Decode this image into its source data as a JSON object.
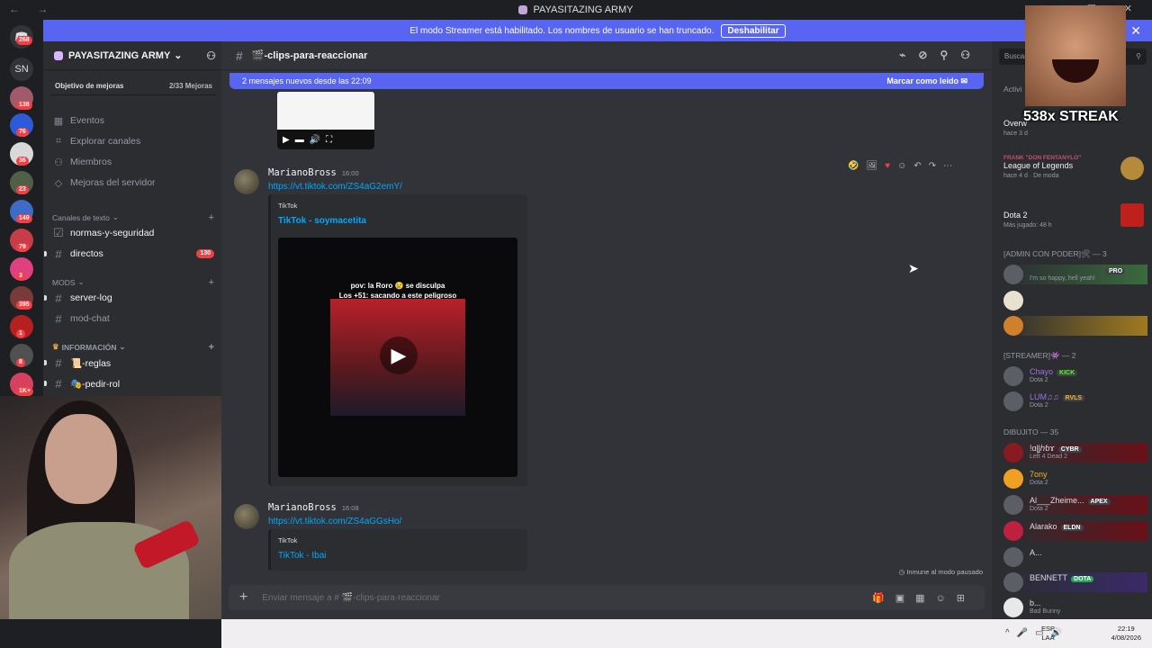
{
  "window": {
    "title": "PAYASITAZING ARMY",
    "nav": "← →",
    "controls": "— ☐ ✕"
  },
  "banner": {
    "text": "El modo Streamer está habilitado. Los nombres de usuario se han truncado.",
    "button": "Deshabilitar",
    "close": "✕"
  },
  "rail": {
    "sn": "SN",
    "badges": [
      "268",
      "138",
      "76",
      "36",
      "23",
      "149",
      "79",
      "3",
      "395",
      "1",
      "8",
      "1K+"
    ]
  },
  "server": {
    "name": "PAYASITAZING ARMY",
    "boost_label": "Objetivo de mejoras",
    "boost_count": "2/33 Mejoras",
    "nav": [
      "Eventos",
      "Explorar canales",
      "Miembros",
      "Mejoras del servidor"
    ],
    "categories": {
      "text": "Canales de texto",
      "mods": "MODS",
      "info": "INFORMACIÓN"
    },
    "channels": {
      "normas": "normas-y-seguridad",
      "directos": "directos",
      "directos_badge": "130",
      "server_log": "server-log",
      "mod_chat": "mod-chat",
      "reglas": "📜-reglas",
      "pedir_rol": "🎭-pedir-rol"
    }
  },
  "channel": {
    "name": "🎬-clips-para-reaccionar",
    "new_messages": "2 mensajes nuevos desde las 22:09",
    "mark_read": "Marcar como leído",
    "composer_placeholder": "Enviar mensaje a # 🎬-clips-para-reaccionar",
    "footnote": "Inmune al modo pausado",
    "search": "Buscar"
  },
  "messages": [
    {
      "author": "MarianoBross",
      "time": "16:00",
      "link": "https://vt.tiktok.com/ZS4aG2emY/",
      "provider": "TikTok",
      "embed_title": "TikTok - soymacetita",
      "caption_1": "pov: la Roro 😢 se disculpa",
      "caption_2": "Los +51: sacando a este peligroso"
    },
    {
      "author": "MarianoBross",
      "time": "16:08",
      "link": "https://vt.tiktok.com/ZS4aGGsHo/",
      "provider": "TikTok",
      "embed_title": "TikTok - Ibai"
    }
  ],
  "members": {
    "activity_title": "Activi",
    "activities": [
      {
        "game": "Overw",
        "sub": "hace 3 d"
      },
      {
        "user": "FRANK \"DON FENTANYLO\"",
        "game": "League of Legends",
        "sub": "hace 4 d · De moda"
      },
      {
        "game": "Dota 2",
        "sub": "Más jugado: 48 h"
      }
    ],
    "groups": {
      "admin": "[ADMIN CON PODER]🛠 — 3",
      "streamer": "[STREAMER]👾 — 2",
      "dibujito": "DIBUJITO — 35"
    },
    "admin_status": "I'm so happy, hell yeah!",
    "admin_tag": "PRO",
    "streamers": [
      {
        "name": "Chayo",
        "tag": "KICK",
        "status": "Dota 2"
      },
      {
        "name": "LUM♫♫",
        "tag": "RVLS",
        "status": "Dota 2"
      }
    ],
    "list": [
      {
        "name": "!ɑɭɭℎɓɤ",
        "tag": "CYBR",
        "status": "Left 4 Dead 2"
      },
      {
        "name": "7ony",
        "tag": "",
        "status": "Dota 2"
      },
      {
        "name": "Al___Zheime...",
        "tag": "APEX",
        "status": "Dota 2"
      },
      {
        "name": "Alarako",
        "tag": "ELDN",
        "status": ""
      },
      {
        "name": "A...",
        "tag": "",
        "status": ""
      },
      {
        "name": "BENNETT",
        "tag": "DOTA",
        "status": ""
      },
      {
        "name": "b...",
        "tag": "",
        "status": "Bad Bunny"
      }
    ]
  },
  "overlay": {
    "text": "538x STREAK"
  },
  "taskbar": {
    "lang_1": "ESP",
    "lang_2": "LAA",
    "time": "22:19",
    "date": "4/08/2026"
  }
}
